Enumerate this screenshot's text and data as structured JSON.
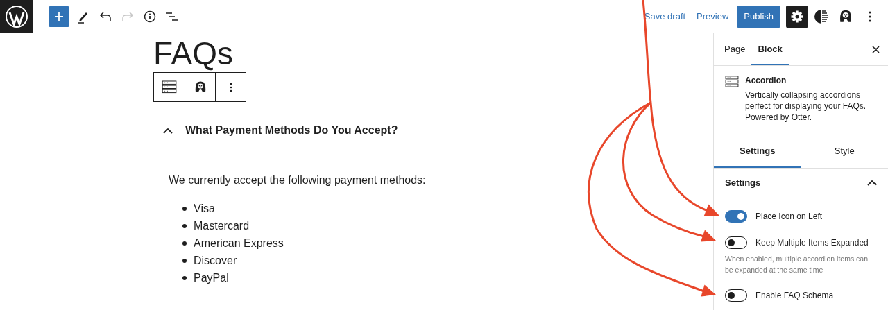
{
  "topbar": {
    "tools": [
      {
        "kind": "add",
        "disabled": false
      },
      {
        "kind": "edit",
        "disabled": false
      },
      {
        "kind": "undo",
        "disabled": false
      },
      {
        "kind": "redo",
        "disabled": true
      },
      {
        "kind": "info",
        "disabled": false
      },
      {
        "kind": "list",
        "disabled": false
      }
    ],
    "save_draft": "Save draft",
    "preview": "Preview",
    "publish": "Publish",
    "settings_open": true
  },
  "editor": {
    "title": "FAQs",
    "accordion": {
      "question": "What Payment Methods Do You Accept?",
      "expanded": true,
      "intro": "We currently accept the following payment methods:",
      "items": [
        "Visa",
        "Mastercard",
        "American Express",
        "Discover",
        "PayPal"
      ]
    }
  },
  "sidebar": {
    "tabs": [
      {
        "label": "Page",
        "selected": false
      },
      {
        "label": "Block",
        "selected": true
      }
    ],
    "block": {
      "name": "Accordion",
      "description": "Vertically collapsing accordions perfect for displaying your FAQs. Powered by Otter."
    },
    "subtabs": [
      {
        "label": "Settings",
        "selected": true
      },
      {
        "label": "Style",
        "selected": false
      }
    ],
    "panel": {
      "title": "Settings",
      "expanded": true,
      "toggles": [
        {
          "label": "Place Icon on Left",
          "on": true
        },
        {
          "label": "Keep Multiple Items Expanded",
          "on": false,
          "help": "When enabled, multiple accordion items can be expanded at the same time"
        },
        {
          "label": "Enable FAQ Schema",
          "on": false
        }
      ]
    }
  }
}
